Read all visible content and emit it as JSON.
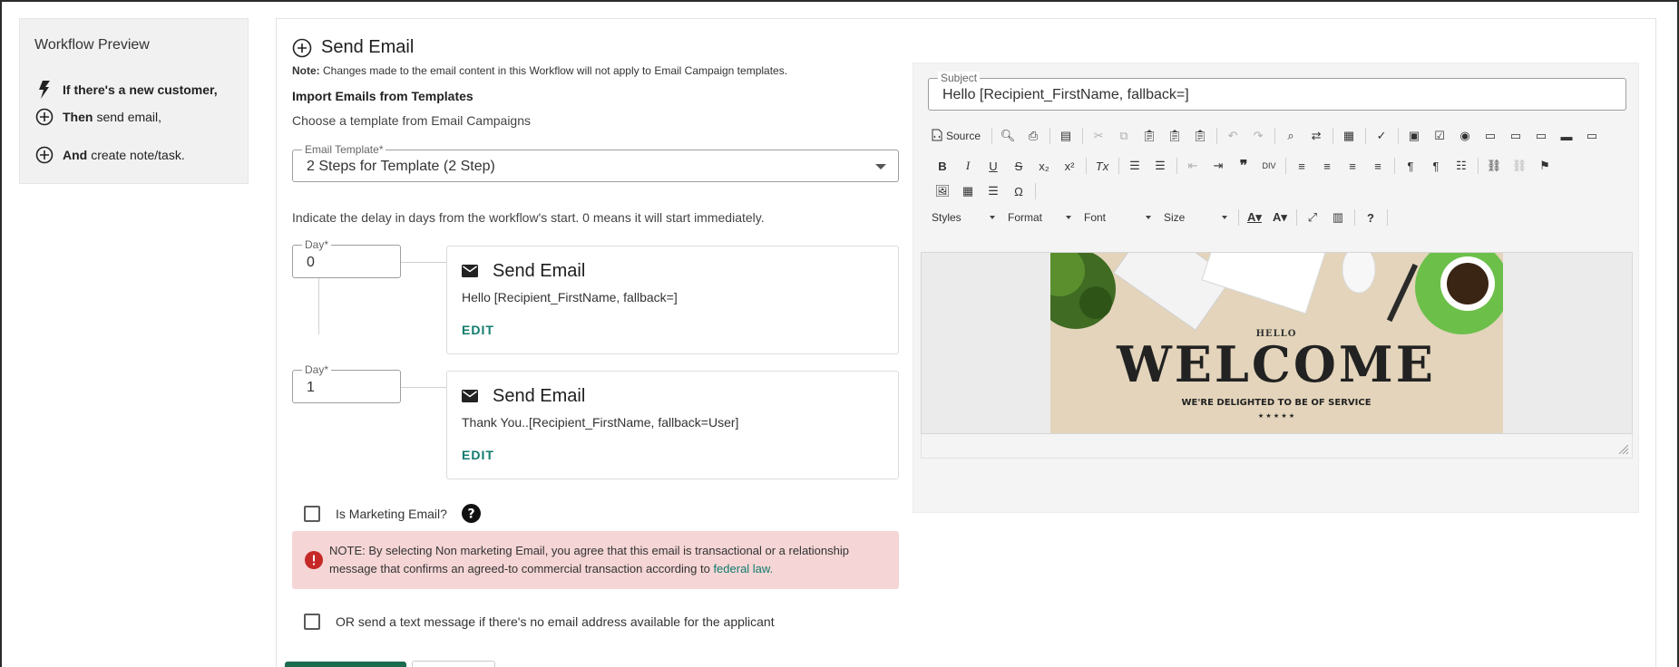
{
  "preview": {
    "title": "Workflow Preview",
    "items": [
      {
        "bold": "If there's a new customer,",
        "rest": "",
        "icon": "lightning-icon"
      },
      {
        "bold": "Then",
        "rest": "send email,",
        "icon": "plus-circle-icon"
      },
      {
        "bold": "And",
        "rest": "create note/task.",
        "icon": "plus-circle-icon"
      }
    ]
  },
  "main": {
    "title": "Send Email",
    "note_label": "Note:",
    "note_text": "Changes made to the email content in this Workflow will not apply to Email Campaign templates.",
    "import_title": "Import Emails from Templates",
    "choose_text": "Choose a template from Email Campaigns",
    "template_label": "Email Template*",
    "template_value": "2 Steps for Template (2 Step)",
    "delay_text": "Indicate the delay in days from the workflow's start. 0 means it will start immediately.",
    "steps": [
      {
        "day_label": "Day*",
        "day_value": "0",
        "title": "Send Email",
        "body": "Hello [Recipient_FirstName, fallback=]",
        "edit": "EDIT"
      },
      {
        "day_label": "Day*",
        "day_value": "1",
        "title": "Send Email",
        "body": "Thank You..[Recipient_FirstName, fallback=User]",
        "edit": "EDIT"
      }
    ],
    "marketing_label": "Is Marketing Email?",
    "alert_text": "NOTE: By selecting Non marketing Email, you agree that this email is transactional or a relationship message that confirms an agreed-to commercial transaction according to",
    "alert_link": "federal law.",
    "sms_label": "OR send a text message if there's no email address available for the applicant"
  },
  "editor": {
    "subject_label": "Subject",
    "subject_value": "Hello [Recipient_FirstName, fallback=]",
    "source_label": "Source",
    "styles_label": "Styles",
    "format_label": "Format",
    "font_label": "Font",
    "size_label": "Size",
    "banner": {
      "small": "HELLO",
      "big": "WELCOME",
      "sub": "WE'RE DELIGHTED TO BE OF SERVICE",
      "stars": "★ ★ ★ ★ ★"
    }
  },
  "colors": {
    "accent_green": "#0f7b6c",
    "alert_bg": "#f5d5d5",
    "alert_icon": "#c62828",
    "button_green": "#1b6b4f"
  }
}
